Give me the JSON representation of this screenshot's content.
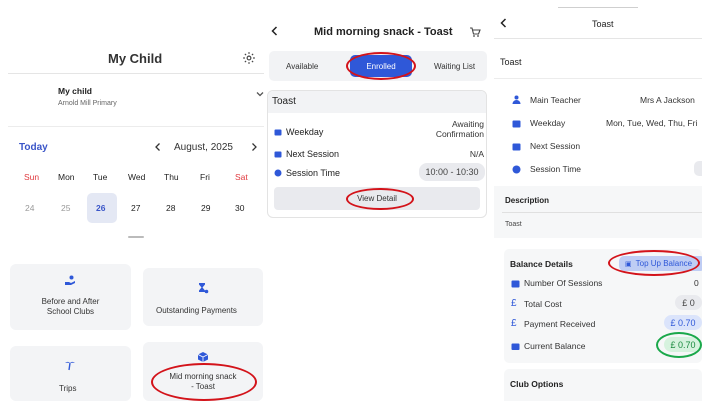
{
  "panel1": {
    "title": "My Child",
    "child_name": "My child",
    "school": "Arnold Mill Primary",
    "today_label": "Today",
    "month": "August, 2025",
    "weekdays": [
      "Sun",
      "Mon",
      "Tue",
      "Wed",
      "Thu",
      "Fri",
      "Sat"
    ],
    "days": [
      "24",
      "25",
      "26",
      "27",
      "28",
      "29",
      "30"
    ],
    "selected_day": "26",
    "tiles": [
      {
        "label": "Before and After\nSchool Clubs",
        "icon": "hand-coin-icon"
      },
      {
        "label": "Outstanding Payments",
        "icon": "hourglass-icon"
      },
      {
        "label": "Trips",
        "icon": "palm-tree-icon"
      },
      {
        "label": "Mid morning snack\n- Toast",
        "icon": "package-icon"
      }
    ]
  },
  "panel2": {
    "title": "Mid morning snack - Toast",
    "tabs": [
      "Available",
      "Enrolled",
      "Waiting List"
    ],
    "active_tab": "Enrolled",
    "card_title": "Toast",
    "rows": [
      {
        "label": "Weekday",
        "value": "Awaiting\nConfirmation"
      },
      {
        "label": "Next Session",
        "value": "N/A"
      },
      {
        "label": "Session Time",
        "value": "10:00 - 10:30"
      }
    ],
    "view_button": "View Detail"
  },
  "panel3": {
    "title": "Toast",
    "name": "Toast",
    "rows": [
      {
        "label": "Main Teacher",
        "value": "Mrs A Jackson"
      },
      {
        "label": "Weekday",
        "value": "Mon, Tue, Wed, Thu, Fri"
      },
      {
        "label": "Next Session",
        "value": ""
      },
      {
        "label": "Session Time",
        "value": ""
      }
    ],
    "description_label": "Description",
    "description": "Toast",
    "balance_title": "Balance Details",
    "top_up": "Top Up Balance",
    "balance_rows": [
      {
        "label": "Number Of Sessions",
        "value": "0"
      },
      {
        "label": "Total Cost",
        "value": "£ 0"
      },
      {
        "label": "Payment Received",
        "value": "£ 0.70"
      },
      {
        "label": "Current Balance",
        "value": "£ 0.70"
      }
    ],
    "club_options": "Club Options"
  },
  "colors": {
    "accent": "#2f58d8",
    "today": "#3a55c8",
    "weekend": "#e0393e",
    "annotation": "#d3131a",
    "balance_green": "#1aa84a"
  }
}
